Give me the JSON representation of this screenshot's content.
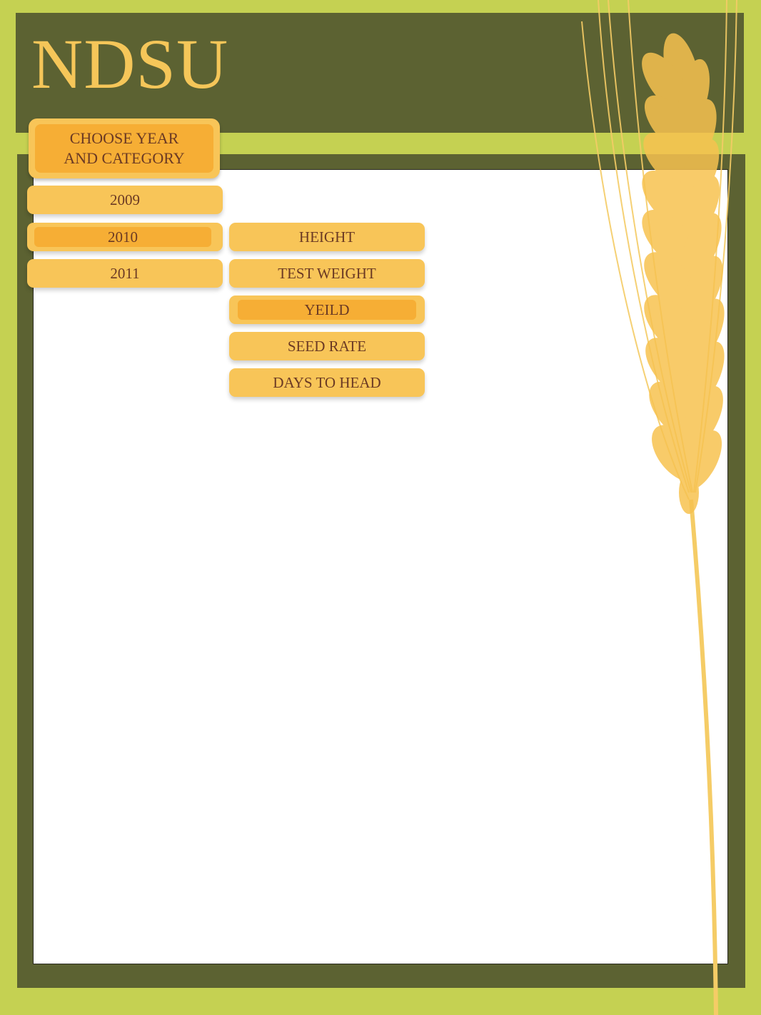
{
  "header": {
    "logo_text": "NDSU"
  },
  "menu": {
    "chooser_line1": "CHOOSE YEAR",
    "chooser_line2": "AND CATEGORY",
    "years": [
      {
        "label": "2009",
        "selected": false
      },
      {
        "label": "2010",
        "selected": true
      },
      {
        "label": "2011",
        "selected": false
      }
    ],
    "categories": [
      {
        "label": "HEIGHT",
        "selected": false
      },
      {
        "label": "TEST WEIGHT",
        "selected": false
      },
      {
        "label": "YEILD",
        "selected": true
      },
      {
        "label": "SEED RATE",
        "selected": false
      },
      {
        "label": "DAYS TO HEAD",
        "selected": false
      }
    ]
  },
  "colors": {
    "background": "#c5d152",
    "frame": "#5c6232",
    "button": "#f8c558",
    "button_selected": "#f6ae35",
    "button_text": "#6b3a24",
    "logo": "#f5c659"
  },
  "icons": {
    "decoration": "wheat-stalk-icon"
  }
}
